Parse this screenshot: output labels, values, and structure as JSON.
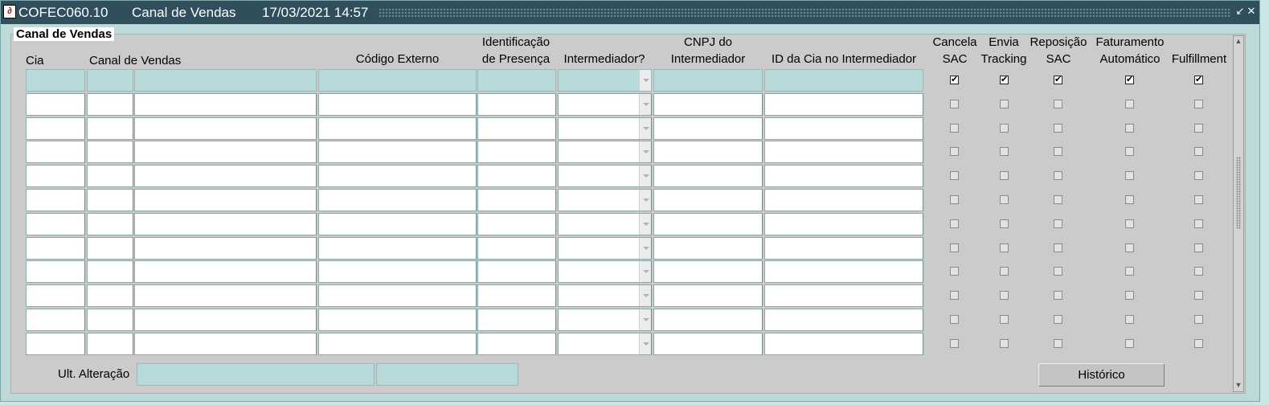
{
  "window": {
    "module": "COFEC060.10",
    "name": "Canal de Vendas",
    "datetime": "17/03/2021 14:57",
    "icon": "oracle-forms-icon",
    "minimize_icon": "↙",
    "close_icon": "✕"
  },
  "panel": {
    "title": "Canal de Vendas"
  },
  "headers": {
    "cia": "Cia",
    "canal": "Canal de Vendas",
    "codigo": "Código Externo",
    "ident_1": "Identificação",
    "ident_2": "de Presença",
    "intermediador": "Intermediador?",
    "cnpj_1": "CNPJ do",
    "cnpj_2": "Intermediador",
    "idcia": "ID da Cia no Intermediador",
    "cancela_1": "Cancela",
    "cancela_2": "SAC",
    "envia_1": "Envia",
    "envia_2": "Tracking",
    "repos_1": "Reposição",
    "repos_2": "SAC",
    "fat_1": "Faturamento",
    "fat_2": "Automático",
    "fulfill": "Fulfillment"
  },
  "rows": [
    {
      "checks": [
        true,
        true,
        true,
        true,
        true
      ]
    },
    {
      "checks": [
        false,
        false,
        false,
        false,
        false
      ]
    },
    {
      "checks": [
        false,
        false,
        false,
        false,
        false
      ]
    },
    {
      "checks": [
        false,
        false,
        false,
        false,
        false
      ]
    },
    {
      "checks": [
        false,
        false,
        false,
        false,
        false
      ]
    },
    {
      "checks": [
        false,
        false,
        false,
        false,
        false
      ]
    },
    {
      "checks": [
        false,
        false,
        false,
        false,
        false
      ]
    },
    {
      "checks": [
        false,
        false,
        false,
        false,
        false
      ]
    },
    {
      "checks": [
        false,
        false,
        false,
        false,
        false
      ]
    },
    {
      "checks": [
        false,
        false,
        false,
        false,
        false
      ]
    },
    {
      "checks": [
        false,
        false,
        false,
        false,
        false
      ]
    },
    {
      "checks": [
        false,
        false,
        false,
        false,
        false
      ]
    }
  ],
  "footer": {
    "ult_label": "Ult. Alteração",
    "ult_user": "",
    "ult_date": "",
    "historico_label": "Histórico"
  },
  "check_glyph": "✔"
}
